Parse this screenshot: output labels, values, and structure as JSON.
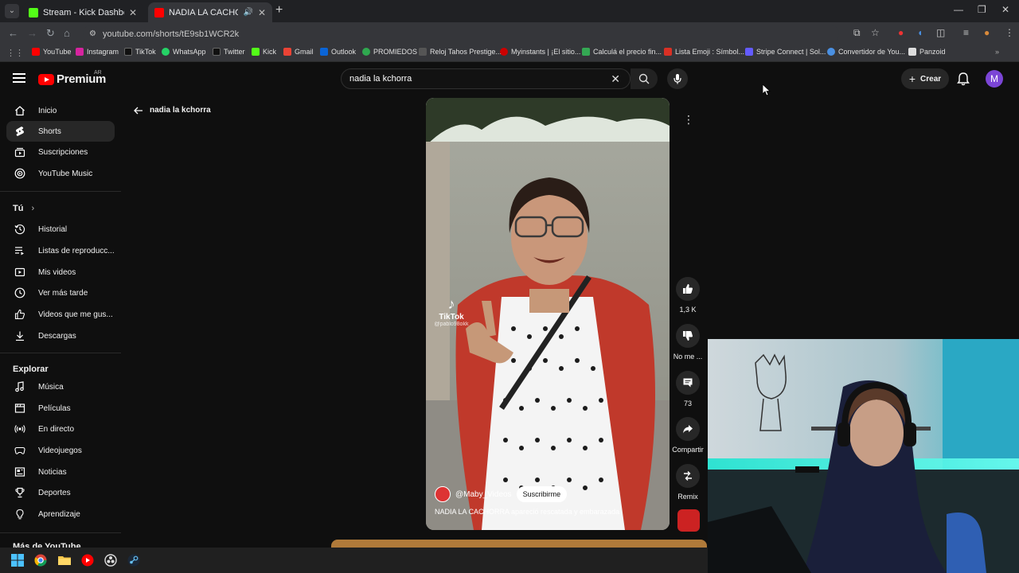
{
  "browser": {
    "tabs": [
      {
        "title": "Stream - Kick Dashboard",
        "favicon_color": "#53fc18",
        "active": false
      },
      {
        "title": "NADIA LA CACHORRA apa",
        "favicon_color": "#ff0000",
        "active": true
      }
    ],
    "url": "youtube.com/shorts/tE9sb1WCR2k",
    "bookmarks": [
      {
        "label": "YouTube",
        "color": "#ff0000"
      },
      {
        "label": "Instagram",
        "color": "#d6249f"
      },
      {
        "label": "TikTok",
        "color": "#111111"
      },
      {
        "label": "WhatsApp",
        "color": "#25d366"
      },
      {
        "label": "Twitter",
        "color": "#111111"
      },
      {
        "label": "Kick",
        "color": "#53fc18"
      },
      {
        "label": "Gmail",
        "color": "#ea4335"
      },
      {
        "label": "Outlook",
        "color": "#0a64d6"
      },
      {
        "label": "PROMIEDOS",
        "color": "#2fa84f"
      },
      {
        "label": "Reloj Tahos Prestige...",
        "color": "#555555"
      },
      {
        "label": "Myinstants | ¡El sitio...",
        "color": "#cc0000"
      },
      {
        "label": "Calculá el precio fin...",
        "color": "#34a853"
      },
      {
        "label": "Lista Emoji : Símbol...",
        "color": "#d93025"
      },
      {
        "label": "Stripe Connect | Sol...",
        "color": "#635bff"
      },
      {
        "label": "Convertidor de You...",
        "color": "#4a90e2"
      },
      {
        "label": "Panzoid",
        "color": "#dddddd"
      }
    ]
  },
  "youtube": {
    "logo_text": "Premium",
    "country_code": "AR",
    "search_value": "nadia la kchorra",
    "create_label": "Crear",
    "avatar_letter": "M",
    "colors": {
      "brand": "#ff0000",
      "avatar": "#7b45d6"
    }
  },
  "sidebar": {
    "main": [
      {
        "label": "Inicio",
        "icon": "home-icon"
      },
      {
        "label": "Shorts",
        "icon": "shorts-icon",
        "active": true
      },
      {
        "label": "Suscripciones",
        "icon": "subscriptions-icon"
      },
      {
        "label": "YouTube Music",
        "icon": "music-icon"
      }
    ],
    "you_heading": "Tú",
    "you": [
      {
        "label": "Historial",
        "icon": "history-icon"
      },
      {
        "label": "Listas de reproducc...",
        "icon": "playlist-icon"
      },
      {
        "label": "Mis videos",
        "icon": "my-videos-icon"
      },
      {
        "label": "Ver más tarde",
        "icon": "watch-later-icon"
      },
      {
        "label": "Videos que me gus...",
        "icon": "liked-icon"
      },
      {
        "label": "Descargas",
        "icon": "download-icon"
      }
    ],
    "explore_heading": "Explorar",
    "explore": [
      {
        "label": "Música",
        "icon": "music-note-icon"
      },
      {
        "label": "Películas",
        "icon": "movies-icon"
      },
      {
        "label": "En directo",
        "icon": "live-icon"
      },
      {
        "label": "Videojuegos",
        "icon": "gaming-icon"
      },
      {
        "label": "Noticias",
        "icon": "news-icon"
      },
      {
        "label": "Deportes",
        "icon": "trophy-icon"
      },
      {
        "label": "Aprendizaje",
        "icon": "learning-icon"
      }
    ],
    "more_heading": "Más de YouTube"
  },
  "shorts": {
    "back_label": "nadia la kchorra",
    "watermark": "TikTok",
    "watermark_handle": "@pablo98okk",
    "channel": "@Maby_Videos",
    "subscribe_label": "Suscribirme",
    "title": "NADIA LA CACHORRA apareció rescatada y embarazada",
    "actions": {
      "likes": "1,3 K",
      "dislike_label": "No me ...",
      "comments": "73",
      "share_label": "Compartir",
      "remix_label": "Remix"
    }
  }
}
